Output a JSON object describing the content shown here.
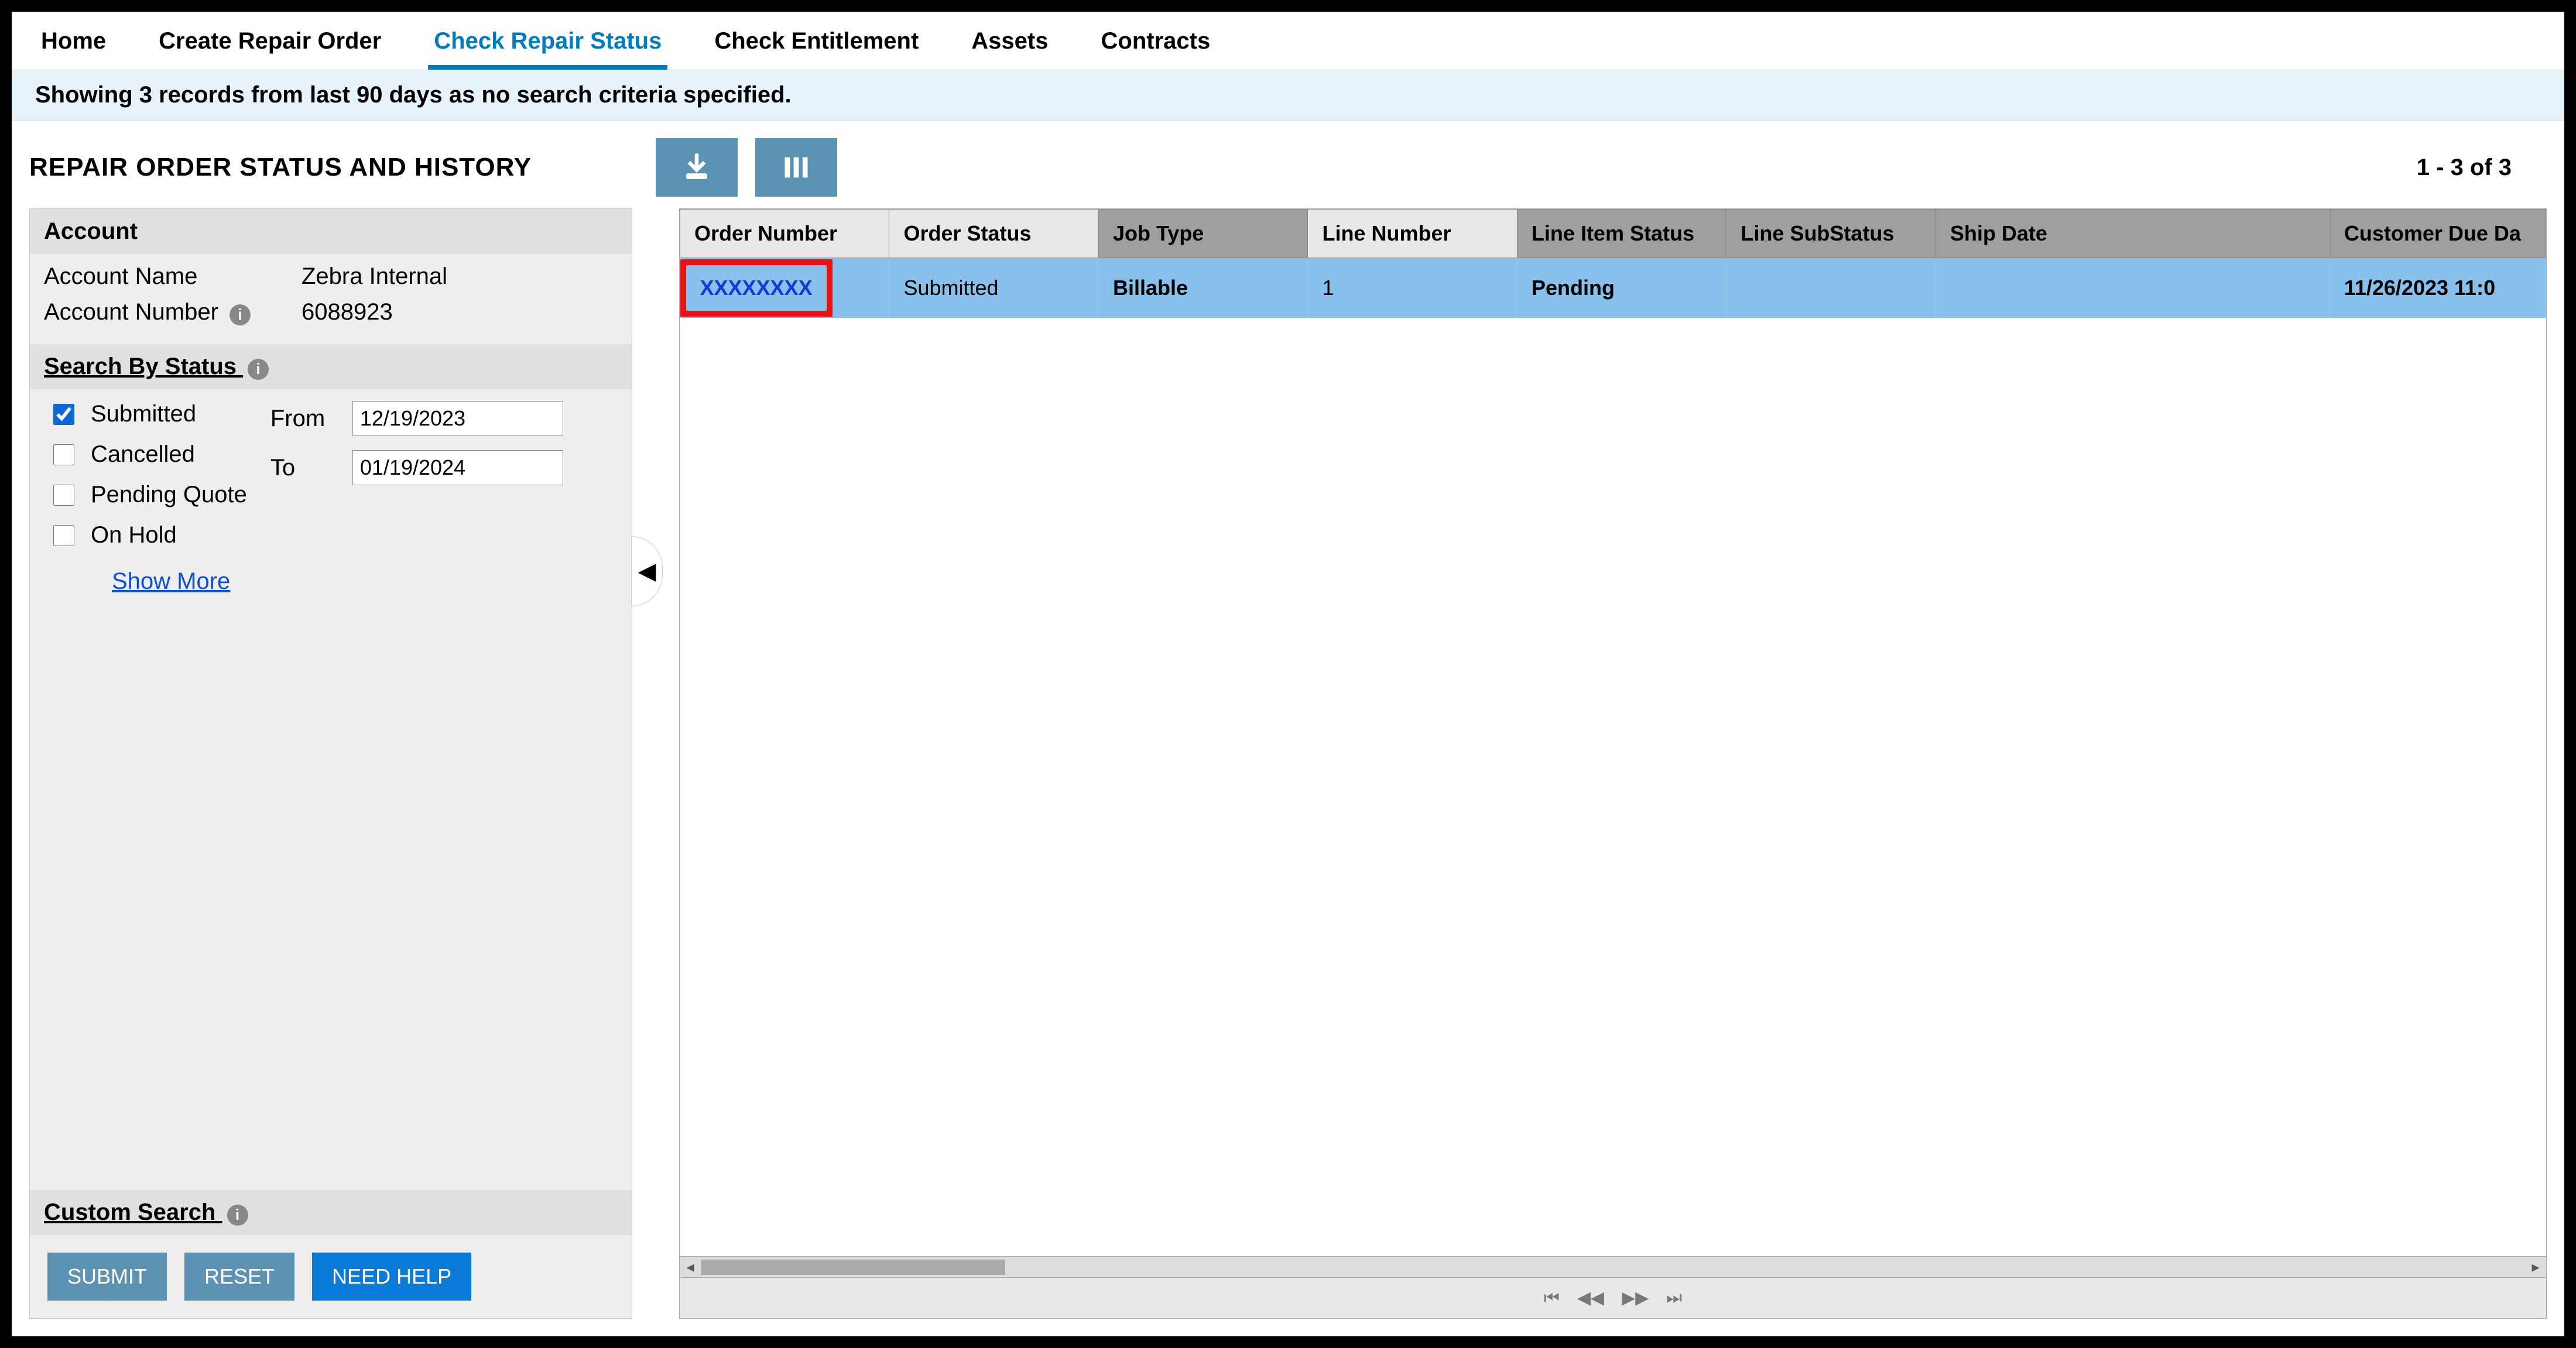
{
  "tabs": {
    "items": [
      {
        "label": "Home",
        "active": false
      },
      {
        "label": "Create Repair Order",
        "active": false
      },
      {
        "label": "Check Repair Status",
        "active": true
      },
      {
        "label": "Check Entitlement",
        "active": false
      },
      {
        "label": "Assets",
        "active": false
      },
      {
        "label": "Contracts",
        "active": false
      }
    ]
  },
  "banner": {
    "text": "Showing 3 records from last 90 days as no search criteria specified."
  },
  "page_title": "REPAIR ORDER STATUS AND HISTORY",
  "records_range": "1 - 3 of 3",
  "account": {
    "heading": "Account",
    "name_label": "Account Name",
    "name_value": "Zebra Internal",
    "number_label": "Account Number",
    "number_value": "6088923"
  },
  "search_status": {
    "heading": "Search By Status",
    "options": {
      "submitted": "Submitted",
      "cancelled": "Cancelled",
      "pending_quote": "Pending Quote",
      "on_hold": "On Hold"
    },
    "checked": {
      "submitted": true,
      "cancelled": false,
      "pending_quote": false,
      "on_hold": false
    },
    "show_more": "Show More",
    "from_label": "From",
    "to_label": "To",
    "from_value": "12/19/2023",
    "to_value": "01/19/2024"
  },
  "custom_search": {
    "heading": "Custom Search"
  },
  "buttons": {
    "submit": "SUBMIT",
    "reset": "RESET",
    "need_help": "NEED HELP"
  },
  "table": {
    "headers": {
      "order_number": "Order Number",
      "order_status": "Order Status",
      "job_type": "Job Type",
      "line_number": "Line Number",
      "line_item_status": "Line Item Status",
      "line_substatus": "Line SubStatus",
      "ship_date": "Ship Date",
      "customer_due_date": "Customer Due Da"
    },
    "rows": [
      {
        "order_number": "XXXXXXXX",
        "order_status": "Submitted",
        "job_type": "Billable",
        "line_number": "1",
        "line_item_status": "Pending",
        "line_substatus": "",
        "ship_date": "",
        "customer_due_date": "11/26/2023 11:0"
      }
    ]
  }
}
